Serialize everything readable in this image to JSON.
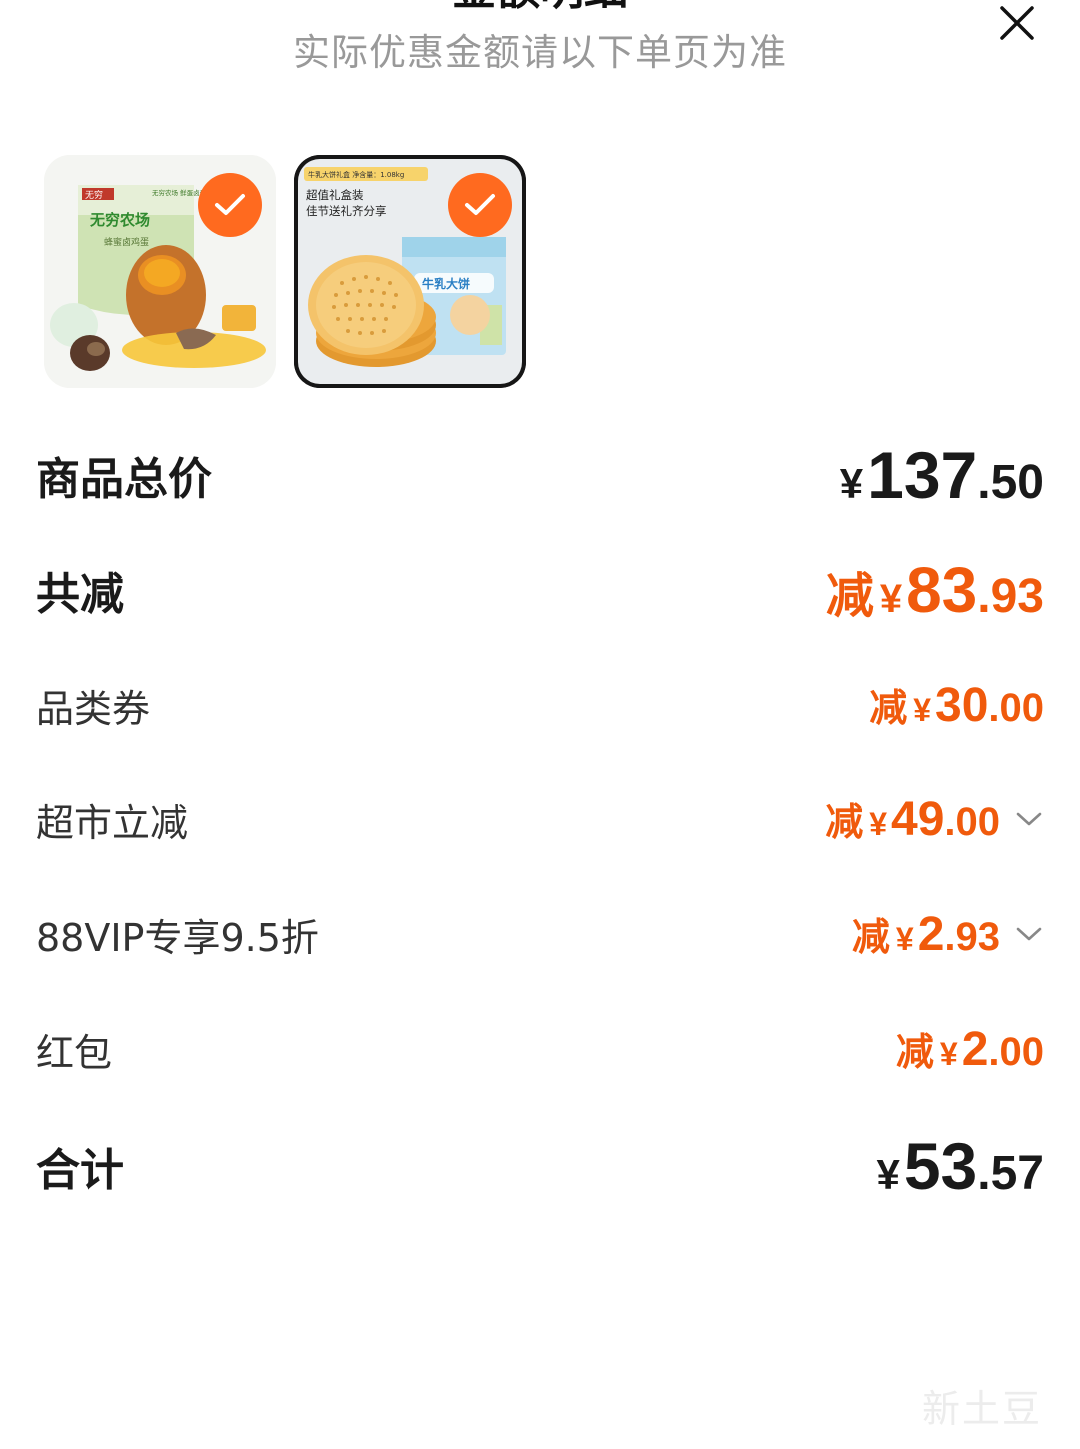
{
  "header": {
    "title": "金额明细",
    "subtitle": "实际优惠金额请以下单页为准"
  },
  "products": [
    {
      "package_brand": "无穷",
      "package_name": "无穷农场",
      "package_badge": "无穷农场 鲜蛋卤蛋",
      "package_flavor": "蜂蜜卤鸡蛋",
      "selected": true
    },
    {
      "banner": "牛乳大饼礼盒  净含量：1.08kg",
      "tagline_1": "超值礼盒装",
      "tagline_2": "佳节送礼齐分享",
      "box_text": "牛乳大饼",
      "selected": true
    }
  ],
  "summary": {
    "total": {
      "label": "商品总价",
      "yen": "¥",
      "integer": "137",
      "decimal": ".50"
    },
    "discount_total": {
      "label": "共减",
      "prefix": "减",
      "yen": "¥",
      "integer": "83",
      "decimal": ".93"
    },
    "items": [
      {
        "label": "品类券",
        "prefix": "减",
        "yen": "¥",
        "integer": "30",
        "decimal": ".00",
        "expandable": false
      },
      {
        "label": "超市立减",
        "prefix": "减",
        "yen": "¥",
        "integer": "49",
        "decimal": ".00",
        "expandable": true
      },
      {
        "label": "88VIP专享9.5折",
        "prefix": "减",
        "yen": "¥",
        "integer": "2",
        "decimal": ".93",
        "expandable": true
      },
      {
        "label": "红包",
        "prefix": "减",
        "yen": "¥",
        "integer": "2",
        "decimal": ".00",
        "expandable": false
      }
    ],
    "grand_total": {
      "label": "合计",
      "yen": "¥",
      "integer": "53",
      "decimal": ".57"
    }
  },
  "watermark": "新土豆",
  "colors": {
    "accent": "#f05a0c",
    "check_badge": "#ff6a1f",
    "subtitle": "#999999",
    "text": "#1a1a1a"
  },
  "icons": [
    "close-icon",
    "checkmark-icon",
    "chevron-down-icon"
  ]
}
